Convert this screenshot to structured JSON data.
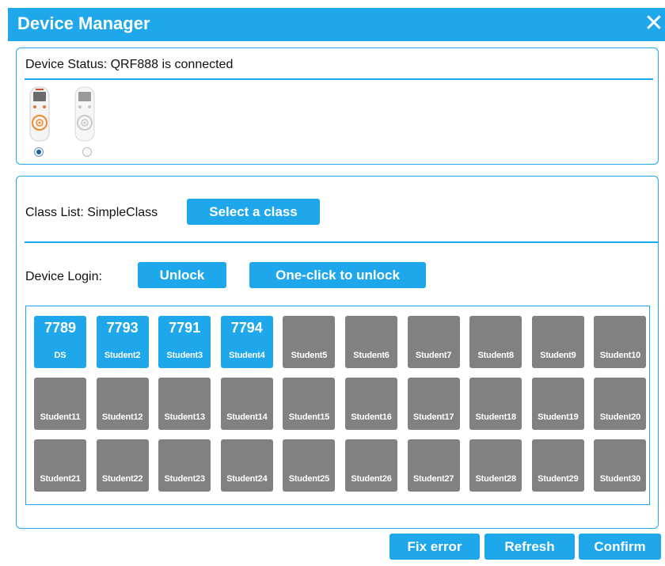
{
  "window": {
    "title": "Device Manager",
    "close_glyph": "✕"
  },
  "device_status": {
    "text": "Device Status: QRF888 is connected",
    "devices": [
      {
        "icon": "remote-control-orange",
        "selected": true
      },
      {
        "icon": "remote-control-gray",
        "selected": false
      }
    ]
  },
  "class_list": {
    "label": "Class List: SimpleClass",
    "select_button": "Select a class"
  },
  "device_login": {
    "label": "Device Login:",
    "unlock_button": "Unlock",
    "one_click_button": "One-click to unlock"
  },
  "students": [
    {
      "num": "7789",
      "name": "DS",
      "active": true
    },
    {
      "num": "7793",
      "name": "Student2",
      "active": true
    },
    {
      "num": "7791",
      "name": "Student3",
      "active": true
    },
    {
      "num": "7794",
      "name": "Student4",
      "active": true
    },
    {
      "num": "",
      "name": "Student5",
      "active": false
    },
    {
      "num": "",
      "name": "Student6",
      "active": false
    },
    {
      "num": "",
      "name": "Student7",
      "active": false
    },
    {
      "num": "",
      "name": "Student8",
      "active": false
    },
    {
      "num": "",
      "name": "Student9",
      "active": false
    },
    {
      "num": "",
      "name": "Student10",
      "active": false
    },
    {
      "num": "",
      "name": "Student11",
      "active": false
    },
    {
      "num": "",
      "name": "Student12",
      "active": false
    },
    {
      "num": "",
      "name": "Student13",
      "active": false
    },
    {
      "num": "",
      "name": "Student14",
      "active": false
    },
    {
      "num": "",
      "name": "Student15",
      "active": false
    },
    {
      "num": "",
      "name": "Student16",
      "active": false
    },
    {
      "num": "",
      "name": "Student17",
      "active": false
    },
    {
      "num": "",
      "name": "Student18",
      "active": false
    },
    {
      "num": "",
      "name": "Student19",
      "active": false
    },
    {
      "num": "",
      "name": "Student20",
      "active": false
    },
    {
      "num": "",
      "name": "Student21",
      "active": false
    },
    {
      "num": "",
      "name": "Student22",
      "active": false
    },
    {
      "num": "",
      "name": "Student23",
      "active": false
    },
    {
      "num": "",
      "name": "Student24",
      "active": false
    },
    {
      "num": "",
      "name": "Student25",
      "active": false
    },
    {
      "num": "",
      "name": "Student26",
      "active": false
    },
    {
      "num": "",
      "name": "Student27",
      "active": false
    },
    {
      "num": "",
      "name": "Student28",
      "active": false
    },
    {
      "num": "",
      "name": "Student29",
      "active": false
    },
    {
      "num": "",
      "name": "Student30",
      "active": false
    }
  ],
  "footer": {
    "fix_error": "Fix error",
    "refresh": "Refresh",
    "confirm": "Confirm"
  },
  "colors": {
    "accent": "#1ea7eb",
    "tile_inactive": "#818181",
    "radio_selected": "#1c5aa8"
  }
}
